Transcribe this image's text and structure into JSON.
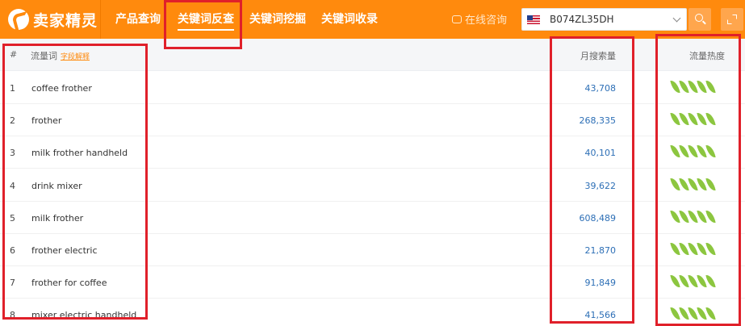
{
  "header": {
    "logo_text": "卖家精灵",
    "nav": [
      "产品查询",
      "关键词反查",
      "关键词挖掘",
      "关键词收录"
    ],
    "consult_label": "在线咨询",
    "search_value": "B074ZL35DH",
    "marketplace_flag": "us-flag-icon"
  },
  "table": {
    "headers": {
      "index": "#",
      "keyword": "流量词",
      "keyword_sort": "字段解释",
      "monthly_search": "月搜索量",
      "heat": "流量热度"
    },
    "rows": [
      {
        "index": "1",
        "keyword": "coffee frother",
        "monthly_search": "43,708",
        "heat": 5
      },
      {
        "index": "2",
        "keyword": "frother",
        "monthly_search": "268,335",
        "heat": 5
      },
      {
        "index": "3",
        "keyword": "milk frother handheld",
        "monthly_search": "40,101",
        "heat": 5
      },
      {
        "index": "4",
        "keyword": "drink mixer",
        "monthly_search": "39,622",
        "heat": 5
      },
      {
        "index": "5",
        "keyword": "milk frother",
        "monthly_search": "608,489",
        "heat": 5
      },
      {
        "index": "6",
        "keyword": "frother electric",
        "monthly_search": "21,870",
        "heat": 5
      },
      {
        "index": "7",
        "keyword": "frother for coffee",
        "monthly_search": "91,849",
        "heat": 5
      },
      {
        "index": "8",
        "keyword": "mixer electric handheld",
        "monthly_search": "41,566",
        "heat": 5
      }
    ]
  },
  "colors": {
    "brand_orange": "#ff8a0d",
    "link_blue": "#2d6fb6",
    "leaf_green": "#8cc63f",
    "annotation_red": "#e0202a"
  }
}
